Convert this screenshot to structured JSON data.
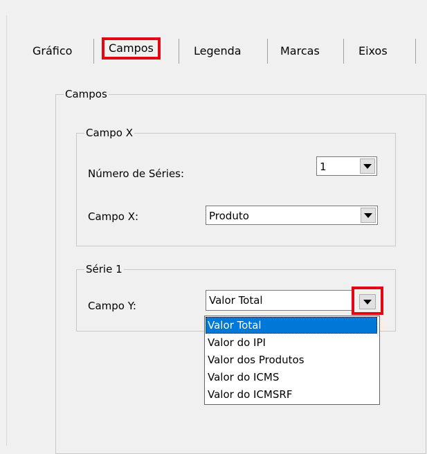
{
  "tabs": [
    {
      "label": "Gráfico"
    },
    {
      "label": "Campos"
    },
    {
      "label": "Legenda"
    },
    {
      "label": "Marcas"
    },
    {
      "label": "Eixos"
    }
  ],
  "campos_group": {
    "title": "Campos"
  },
  "campo_x_group": {
    "title": "Campo X",
    "num_series_label": "Número de Séries:",
    "num_series_value": "1",
    "campo_x_label": "Campo X:",
    "campo_x_value": "Produto"
  },
  "serie_group": {
    "title": "Série 1",
    "campo_y_label": "Campo Y:",
    "campo_y_value": "Valor Total"
  },
  "dropdown_options": [
    "Valor Total",
    "Valor do IPI",
    "Valor dos Produtos",
    "Valor do ICMS",
    "Valor do ICMSRF"
  ],
  "colors": {
    "highlight": "#e30613",
    "selection": "#0078d7"
  }
}
